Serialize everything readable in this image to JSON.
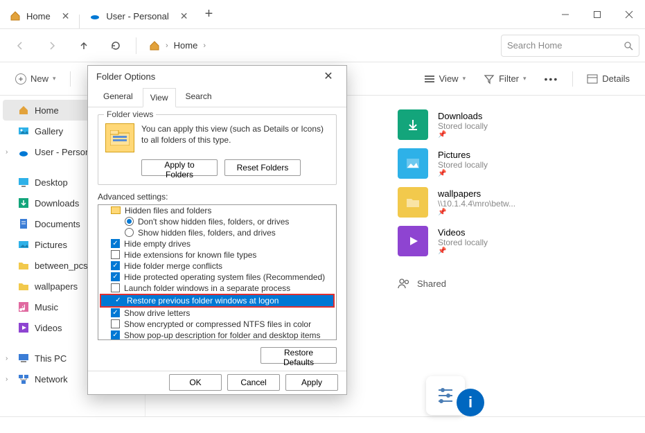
{
  "titlebar": {
    "tabs": [
      {
        "label": "Home",
        "active": true
      },
      {
        "label": "User - Personal",
        "active": false
      }
    ]
  },
  "toolbar": {
    "breadcrumb": "Home",
    "search_placeholder": "Search Home"
  },
  "cmdbar": {
    "new": "New",
    "view": "View",
    "filter": "Filter",
    "details": "Details"
  },
  "nav": {
    "items": [
      {
        "label": "Home",
        "icon": "home",
        "sel": true
      },
      {
        "label": "Gallery",
        "icon": "gallery"
      },
      {
        "label": "User - Person",
        "icon": "onedrive",
        "expandable": true
      },
      {
        "spacer": true
      },
      {
        "label": "Desktop",
        "icon": "desktop"
      },
      {
        "label": "Downloads",
        "icon": "downloads"
      },
      {
        "label": "Documents",
        "icon": "documents"
      },
      {
        "label": "Pictures",
        "icon": "pictures"
      },
      {
        "label": "between_pcs",
        "icon": "folder"
      },
      {
        "label": "wallpapers",
        "icon": "folder"
      },
      {
        "label": "Music",
        "icon": "music"
      },
      {
        "label": "Videos",
        "icon": "videos"
      },
      {
        "spacer": true
      },
      {
        "label": "This PC",
        "icon": "pc",
        "expandable": true
      },
      {
        "label": "Network",
        "icon": "network",
        "expandable": true
      }
    ]
  },
  "content": {
    "shared_label": "Shared",
    "items": [
      {
        "name": "Downloads",
        "sub": "Stored locally",
        "color": "#13a57b",
        "glyph": "down"
      },
      {
        "name": "Pictures",
        "sub": "Stored locally",
        "color": "#2eb1e8",
        "glyph": "image"
      },
      {
        "name": "wallpapers",
        "sub": "\\\\10.1.4.4\\mro\\betw...",
        "color": "#f2c94c",
        "glyph": "folder"
      },
      {
        "name": "Videos",
        "sub": "Stored locally",
        "color": "#8e44d1",
        "glyph": "play"
      }
    ]
  },
  "dialog": {
    "title": "Folder Options",
    "tabs": [
      "General",
      "View",
      "Search"
    ],
    "active_tab": "View",
    "folder_views": {
      "legend": "Folder views",
      "text": "You can apply this view (such as Details or Icons) to all folders of this type.",
      "apply": "Apply to Folders",
      "reset": "Reset Folders"
    },
    "advanced_label": "Advanced settings:",
    "tree": [
      {
        "type": "folder",
        "label": "Hidden files and folders"
      },
      {
        "type": "radio",
        "checked": true,
        "label": "Don't show hidden files, folders, or drives",
        "sub": true
      },
      {
        "type": "radio",
        "checked": false,
        "label": "Show hidden files, folders, and drives",
        "sub": true
      },
      {
        "type": "check",
        "checked": true,
        "label": "Hide empty drives"
      },
      {
        "type": "check",
        "checked": false,
        "label": "Hide extensions for known file types"
      },
      {
        "type": "check",
        "checked": true,
        "label": "Hide folder merge conflicts"
      },
      {
        "type": "check",
        "checked": true,
        "label": "Hide protected operating system files (Recommended)"
      },
      {
        "type": "check",
        "checked": false,
        "label": "Launch folder windows in a separate process"
      },
      {
        "type": "check",
        "checked": true,
        "label": "Restore previous folder windows at logon",
        "hl": true
      },
      {
        "type": "check",
        "checked": true,
        "label": "Show drive letters"
      },
      {
        "type": "check",
        "checked": false,
        "label": "Show encrypted or compressed NTFS files in color"
      },
      {
        "type": "check",
        "checked": true,
        "label": "Show pop-up description for folder and desktop items"
      }
    ],
    "restore_defaults": "Restore Defaults",
    "ok": "OK",
    "cancel": "Cancel",
    "apply": "Apply"
  }
}
